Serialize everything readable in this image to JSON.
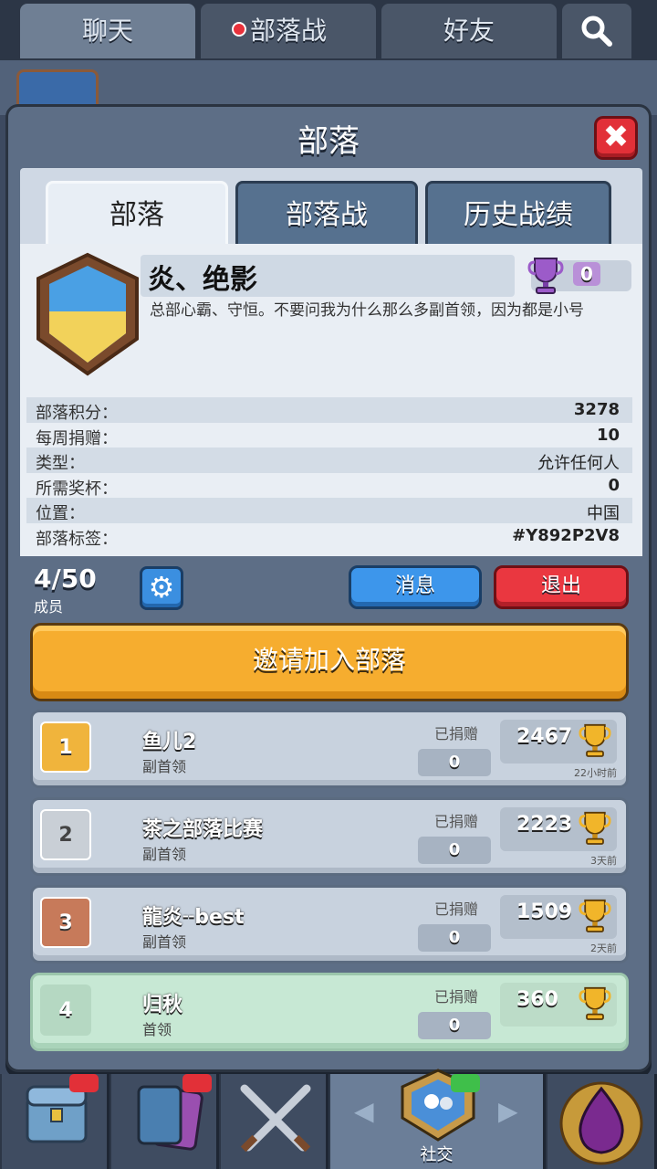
{
  "top_tabs": [
    "聊天",
    "部落战",
    "好友"
  ],
  "modal": {
    "title": "部落",
    "close_label": "✖",
    "tabs": [
      "部落",
      "部落战",
      "历史战绩"
    ]
  },
  "clan": {
    "name": "炎、绝影",
    "trophies": "0",
    "description": "总部心霸、守恒。不要问我为什么那么多副首领，因为都是小号"
  },
  "stats": [
    {
      "label": "部落积分：",
      "value": "3278"
    },
    {
      "label": "每周捐赠：",
      "value": "10"
    },
    {
      "label": "类型：",
      "value": "允许任何人"
    },
    {
      "label": "所需奖杯：",
      "value": "0"
    },
    {
      "label": "位置：",
      "value": "中国"
    },
    {
      "label": "部落标签：",
      "value": "#Y892P2V8"
    }
  ],
  "members_bar": {
    "count": "4/50",
    "count_label": "成员",
    "message_label": "消息",
    "exit_label": "退出"
  },
  "invite_label": "邀请加入部落",
  "members": [
    {
      "rank": "1",
      "name": "鱼儿2",
      "role": "副首领",
      "donated_label": "已捐赠",
      "donated": "0",
      "trophies": "2467",
      "last_seen": "22小时前"
    },
    {
      "rank": "2",
      "name": "茶之部落比赛",
      "role": "副首领",
      "donated_label": "已捐赠",
      "donated": "0",
      "trophies": "2223",
      "last_seen": "3天前"
    },
    {
      "rank": "3",
      "name": "龍炎╌best",
      "role": "副首领",
      "donated_label": "已捐赠",
      "donated": "0",
      "trophies": "1509",
      "last_seen": "2天前"
    },
    {
      "rank": "4",
      "name": "归秋",
      "role": "首领",
      "donated_label": "已捐赠",
      "donated": "0",
      "trophies": "360",
      "last_seen": ""
    }
  ],
  "bottom_nav": {
    "active_label": "社交"
  },
  "icons": {
    "search": "search-icon",
    "gear": "gear-icon",
    "trophy": "trophy-icon",
    "close": "close-icon"
  },
  "colors": {
    "invite_button": "#f6ad2f",
    "message_button": "#3d96eb",
    "exit_button": "#ea3740",
    "rank_gold": "#f0b43c",
    "rank_silver": "#c9cfd6",
    "rank_bronze": "#c77a5a"
  }
}
